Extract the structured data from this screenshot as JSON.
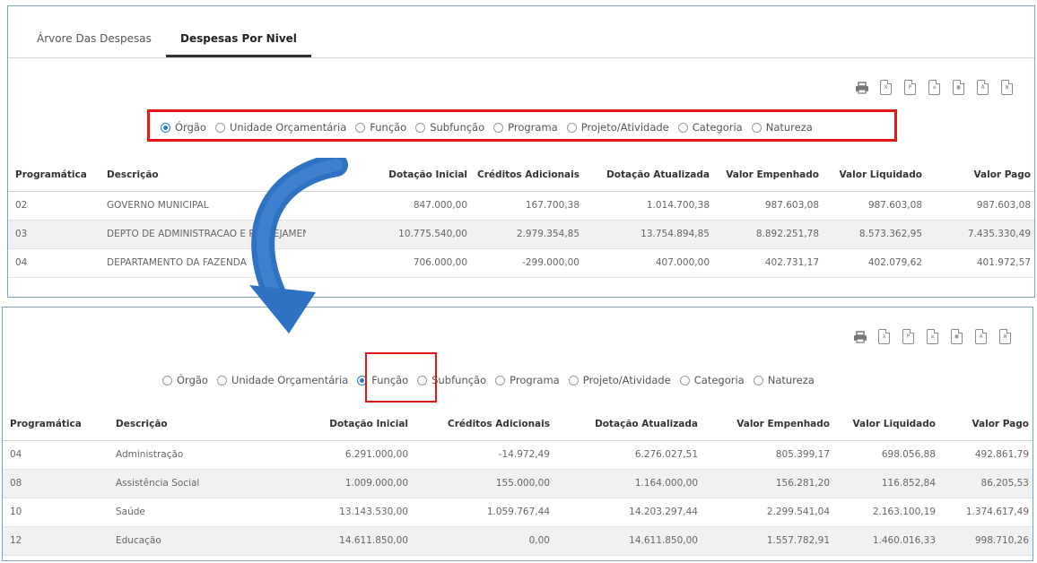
{
  "top_panel": {
    "tabs": [
      "Árvore Das Despesas",
      "Despesas Por Nivel"
    ],
    "active_tab": "Despesas Por Nivel",
    "toolbar": [
      "printer-icon",
      "xls-icon",
      "pdf-icon",
      "txt-icon",
      "csv-icon",
      "xml-icon",
      "doc-icon"
    ],
    "radio_options": [
      "Órgão",
      "Unidade Orçamentária",
      "Função",
      "Subfunção",
      "Programa",
      "Projeto/Atividade",
      "Categoria",
      "Natureza"
    ],
    "selected": "Órgão",
    "columns": [
      "Programática",
      "Descrição",
      "Dotação Inicial",
      "Créditos Adicionais",
      "Dotação Atualizada",
      "Valor Empenhado",
      "Valor Liquidado",
      "Valor Pago"
    ],
    "rows": [
      [
        "02",
        "GOVERNO MUNICIPAL",
        "847.000,00",
        "167.700,38",
        "1.014.700,38",
        "987.603,08",
        "987.603,08",
        "987.603,08"
      ],
      [
        "03",
        "DEPTO DE ADMINISTRACAO E PLANEJAMENTO",
        "10.775.540,00",
        "2.979.354,85",
        "13.754.894,85",
        "8.892.251,78",
        "8.573.362,95",
        "7.435.330,49"
      ],
      [
        "04",
        "DEPARTAMENTO DA FAZENDA",
        "706.000,00",
        "-299.000,00",
        "407.000,00",
        "402.731,17",
        "402.079,62",
        "401.972,57"
      ]
    ]
  },
  "bottom_panel": {
    "toolbar": [
      "printer-icon",
      "xls-icon",
      "pdf-icon",
      "txt-icon",
      "csv-icon",
      "xml-icon",
      "doc-icon"
    ],
    "radio_options": [
      "Órgão",
      "Unidade Orçamentária",
      "Função",
      "Subfunção",
      "Programa",
      "Projeto/Atividade",
      "Categoria",
      "Natureza"
    ],
    "selected": "Função",
    "columns": [
      "Programática",
      "Descrição",
      "Dotação Inicial",
      "Créditos Adicionais",
      "Dotação Atualizada",
      "Valor Empenhado",
      "Valor Liquidado",
      "Valor Pago"
    ],
    "rows": [
      [
        "04",
        "Administração",
        "6.291.000,00",
        "-14.972,49",
        "6.276.027,51",
        "805.399,17",
        "698.056,88",
        "492.861,79"
      ],
      [
        "08",
        "Assistência Social",
        "1.009.000,00",
        "155.000,00",
        "1.164.000,00",
        "156.281,20",
        "116.852,84",
        "86.205,53"
      ],
      [
        "10",
        "Saúde",
        "13.143.530,00",
        "1.059.767,44",
        "14.203.297,44",
        "2.299.541,04",
        "2.163.100,19",
        "1.374.617,49"
      ],
      [
        "12",
        "Educação",
        "14.611.850,00",
        "0,00",
        "14.611.850,00",
        "1.557.782,91",
        "1.460.016,33",
        "998.710,26"
      ]
    ]
  },
  "colors": {
    "highlight": "#e01818",
    "arrow": "#2f72c4",
    "radio_selected": "#2a7ad5"
  }
}
